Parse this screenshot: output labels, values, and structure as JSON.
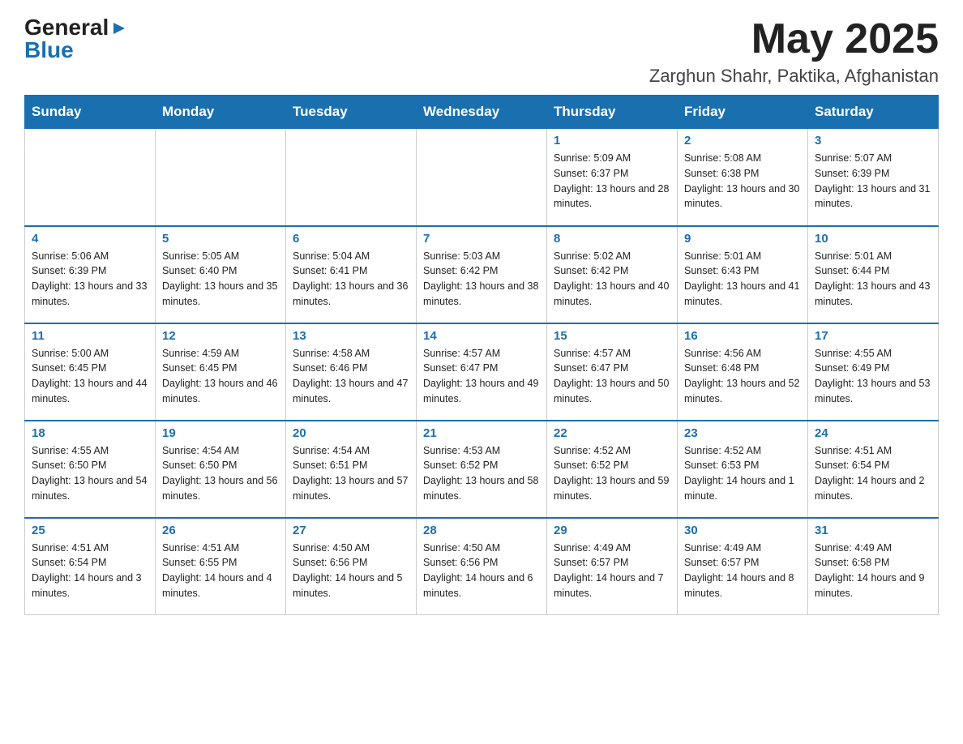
{
  "header": {
    "logo": {
      "general": "General",
      "arrow_symbol": "▶",
      "blue": "Blue"
    },
    "title": "May 2025",
    "location": "Zarghun Shahr, Paktika, Afghanistan"
  },
  "calendar": {
    "days_of_week": [
      "Sunday",
      "Monday",
      "Tuesday",
      "Wednesday",
      "Thursday",
      "Friday",
      "Saturday"
    ],
    "weeks": [
      [
        {
          "day": "",
          "info": ""
        },
        {
          "day": "",
          "info": ""
        },
        {
          "day": "",
          "info": ""
        },
        {
          "day": "",
          "info": ""
        },
        {
          "day": "1",
          "info": "Sunrise: 5:09 AM\nSunset: 6:37 PM\nDaylight: 13 hours and 28 minutes."
        },
        {
          "day": "2",
          "info": "Sunrise: 5:08 AM\nSunset: 6:38 PM\nDaylight: 13 hours and 30 minutes."
        },
        {
          "day": "3",
          "info": "Sunrise: 5:07 AM\nSunset: 6:39 PM\nDaylight: 13 hours and 31 minutes."
        }
      ],
      [
        {
          "day": "4",
          "info": "Sunrise: 5:06 AM\nSunset: 6:39 PM\nDaylight: 13 hours and 33 minutes."
        },
        {
          "day": "5",
          "info": "Sunrise: 5:05 AM\nSunset: 6:40 PM\nDaylight: 13 hours and 35 minutes."
        },
        {
          "day": "6",
          "info": "Sunrise: 5:04 AM\nSunset: 6:41 PM\nDaylight: 13 hours and 36 minutes."
        },
        {
          "day": "7",
          "info": "Sunrise: 5:03 AM\nSunset: 6:42 PM\nDaylight: 13 hours and 38 minutes."
        },
        {
          "day": "8",
          "info": "Sunrise: 5:02 AM\nSunset: 6:42 PM\nDaylight: 13 hours and 40 minutes."
        },
        {
          "day": "9",
          "info": "Sunrise: 5:01 AM\nSunset: 6:43 PM\nDaylight: 13 hours and 41 minutes."
        },
        {
          "day": "10",
          "info": "Sunrise: 5:01 AM\nSunset: 6:44 PM\nDaylight: 13 hours and 43 minutes."
        }
      ],
      [
        {
          "day": "11",
          "info": "Sunrise: 5:00 AM\nSunset: 6:45 PM\nDaylight: 13 hours and 44 minutes."
        },
        {
          "day": "12",
          "info": "Sunrise: 4:59 AM\nSunset: 6:45 PM\nDaylight: 13 hours and 46 minutes."
        },
        {
          "day": "13",
          "info": "Sunrise: 4:58 AM\nSunset: 6:46 PM\nDaylight: 13 hours and 47 minutes."
        },
        {
          "day": "14",
          "info": "Sunrise: 4:57 AM\nSunset: 6:47 PM\nDaylight: 13 hours and 49 minutes."
        },
        {
          "day": "15",
          "info": "Sunrise: 4:57 AM\nSunset: 6:47 PM\nDaylight: 13 hours and 50 minutes."
        },
        {
          "day": "16",
          "info": "Sunrise: 4:56 AM\nSunset: 6:48 PM\nDaylight: 13 hours and 52 minutes."
        },
        {
          "day": "17",
          "info": "Sunrise: 4:55 AM\nSunset: 6:49 PM\nDaylight: 13 hours and 53 minutes."
        }
      ],
      [
        {
          "day": "18",
          "info": "Sunrise: 4:55 AM\nSunset: 6:50 PM\nDaylight: 13 hours and 54 minutes."
        },
        {
          "day": "19",
          "info": "Sunrise: 4:54 AM\nSunset: 6:50 PM\nDaylight: 13 hours and 56 minutes."
        },
        {
          "day": "20",
          "info": "Sunrise: 4:54 AM\nSunset: 6:51 PM\nDaylight: 13 hours and 57 minutes."
        },
        {
          "day": "21",
          "info": "Sunrise: 4:53 AM\nSunset: 6:52 PM\nDaylight: 13 hours and 58 minutes."
        },
        {
          "day": "22",
          "info": "Sunrise: 4:52 AM\nSunset: 6:52 PM\nDaylight: 13 hours and 59 minutes."
        },
        {
          "day": "23",
          "info": "Sunrise: 4:52 AM\nSunset: 6:53 PM\nDaylight: 14 hours and 1 minute."
        },
        {
          "day": "24",
          "info": "Sunrise: 4:51 AM\nSunset: 6:54 PM\nDaylight: 14 hours and 2 minutes."
        }
      ],
      [
        {
          "day": "25",
          "info": "Sunrise: 4:51 AM\nSunset: 6:54 PM\nDaylight: 14 hours and 3 minutes."
        },
        {
          "day": "26",
          "info": "Sunrise: 4:51 AM\nSunset: 6:55 PM\nDaylight: 14 hours and 4 minutes."
        },
        {
          "day": "27",
          "info": "Sunrise: 4:50 AM\nSunset: 6:56 PM\nDaylight: 14 hours and 5 minutes."
        },
        {
          "day": "28",
          "info": "Sunrise: 4:50 AM\nSunset: 6:56 PM\nDaylight: 14 hours and 6 minutes."
        },
        {
          "day": "29",
          "info": "Sunrise: 4:49 AM\nSunset: 6:57 PM\nDaylight: 14 hours and 7 minutes."
        },
        {
          "day": "30",
          "info": "Sunrise: 4:49 AM\nSunset: 6:57 PM\nDaylight: 14 hours and 8 minutes."
        },
        {
          "day": "31",
          "info": "Sunrise: 4:49 AM\nSunset: 6:58 PM\nDaylight: 14 hours and 9 minutes."
        }
      ]
    ]
  }
}
